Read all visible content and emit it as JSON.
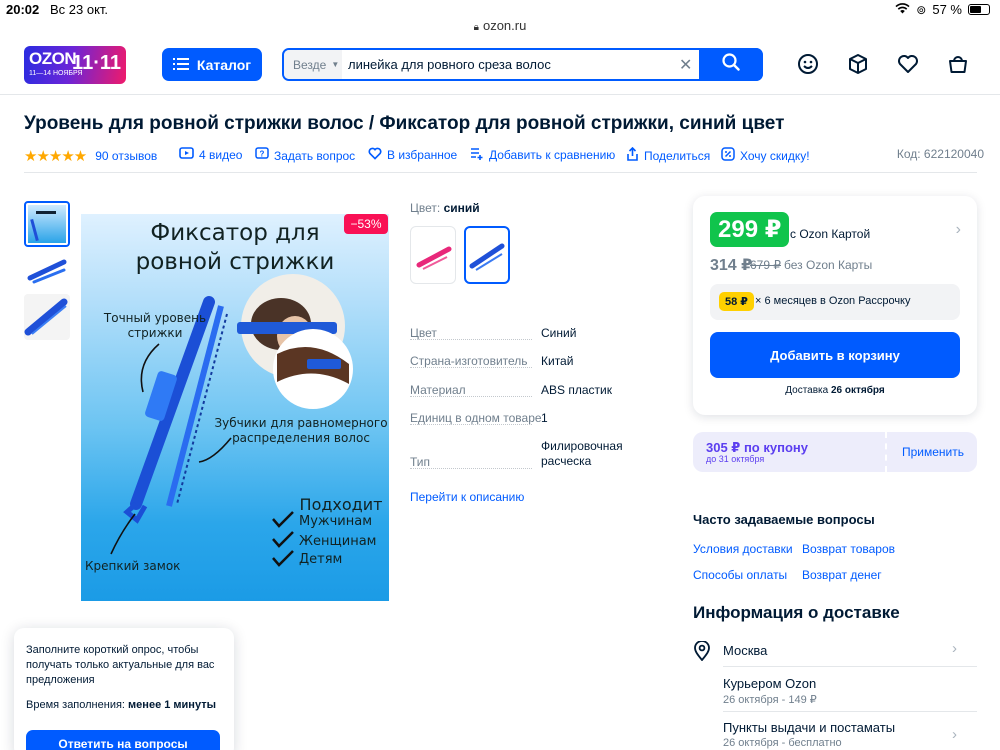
{
  "status_bar": {
    "time": "20:02",
    "date": "Вс 23 окт.",
    "battery": "57 %"
  },
  "browser": {
    "url": "ozon.ru"
  },
  "header": {
    "logo_text": "OZON",
    "logo_promo_dates": "11—14 НОЯБРЯ",
    "logo_promo_big": "11·11",
    "catalog_label": "Каталог",
    "search_scope": "Везде",
    "search_value": "линейка для ровного среза волос",
    "icons": [
      "emoji-icon",
      "box-icon",
      "heart-icon",
      "bag-icon"
    ]
  },
  "product": {
    "title": "Уровень для ровной стрижки волос / Фиксатор для ровной стрижки, синий цвет",
    "rating_stars": "★★★★★",
    "reviews": "90 отзывов",
    "videos": "4 видео",
    "ask_question": "Задать вопрос",
    "favorites": "В избранное",
    "compare": "Добавить к сравнению",
    "share": "Поделиться",
    "want_discount": "Хочу скидку!",
    "sku": "Код: 622120040",
    "discount_badge": "−53%",
    "image_texts": {
      "headline_1": "Фиксатор для",
      "headline_2": "ровной стрижки",
      "feature_1_l1": "Точный уровень",
      "feature_1_l2": "стрижки",
      "feature_2_l1": "Зубчики для равномерного",
      "feature_2_l2": "распределения волос",
      "suits_title": "Подходит",
      "suits_1": "Мужчинам",
      "suits_2": "Женщинам",
      "suits_3": "Детям",
      "lock": "Крепкий замок"
    }
  },
  "variants": {
    "label": "Цвет:",
    "selected": "синий"
  },
  "specs": [
    {
      "name": "Цвет",
      "value": "Синий"
    },
    {
      "name": "Страна-изготовитель",
      "value": "Китай"
    },
    {
      "name": "Материал",
      "value": "ABS пластик"
    },
    {
      "name": "Единиц в одном товаре",
      "value": "1"
    },
    {
      "name": "Тип",
      "value": "Филировочная расческа"
    }
  ],
  "goto_description": "Перейти к описанию",
  "price": {
    "card_price": "299 ₽",
    "card_label": "с Ozon Картой",
    "regular_price": "314 ₽",
    "old_price": "679 ₽",
    "regular_label": "без Ozon Карты",
    "installment_amount": "58 ₽",
    "installment_text": "× 6 месяцев в Ozon Рассрочку",
    "add_to_cart": "Добавить в корзину",
    "delivery_prefix": "Доставка",
    "delivery_date": "26 октября"
  },
  "coupon": {
    "title": "305 ₽ по купону",
    "subtitle": "до 31 октября",
    "apply": "Применить"
  },
  "faq": {
    "title": "Часто задаваемые вопросы",
    "links": [
      "Условия доставки",
      "Возврат товаров",
      "Способы оплаты",
      "Возврат денег"
    ]
  },
  "delivery_info": {
    "title": "Информация о доставке",
    "city": "Москва",
    "options": [
      {
        "title": "Курьером Ozon",
        "subtitle": "26 октября - 149 ₽"
      },
      {
        "title": "Пункты выдачи и постаматы",
        "subtitle": "26 октября - бесплатно"
      }
    ]
  },
  "survey": {
    "text": "Заполните короткий опрос, чтобы получать только актуальные для вас предложения",
    "time_label": "Время заполнения:",
    "time_value": "менее 1 минуты",
    "button": "Ответить на вопросы"
  },
  "colors": {
    "brand_blue": "#005bff",
    "price_green": "#10c44c",
    "discount_red": "#f91155",
    "installment_yellow": "#ffd000",
    "coupon_purple": "#5b3ef0"
  }
}
